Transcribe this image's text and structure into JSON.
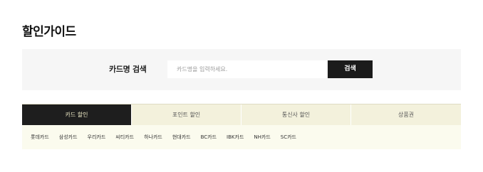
{
  "page": {
    "title": "할인가이드"
  },
  "search": {
    "label": "카드명 검색",
    "placeholder": "카드명을 입력하세요.",
    "value": "",
    "button_label": "검색"
  },
  "tabs": [
    {
      "label": "카드 할인",
      "active": true
    },
    {
      "label": "포인트 할인",
      "active": false
    },
    {
      "label": "통신사 할인",
      "active": false
    },
    {
      "label": "상품권",
      "active": false
    }
  ],
  "cards": [
    "롯데카드",
    "삼성카드",
    "우리카드",
    "씨티카드",
    "하나카드",
    "현대카드",
    "BC카드",
    "IBK카드",
    "NH카드",
    "SC카드"
  ],
  "colors": {
    "active_tab_bg": "#1e1e1e",
    "tab_bar_bg": "#f3f1dc",
    "card_list_bg": "#fbfbee",
    "search_panel_bg": "#f6f6f6",
    "search_button_bg": "#1b1b1b"
  }
}
